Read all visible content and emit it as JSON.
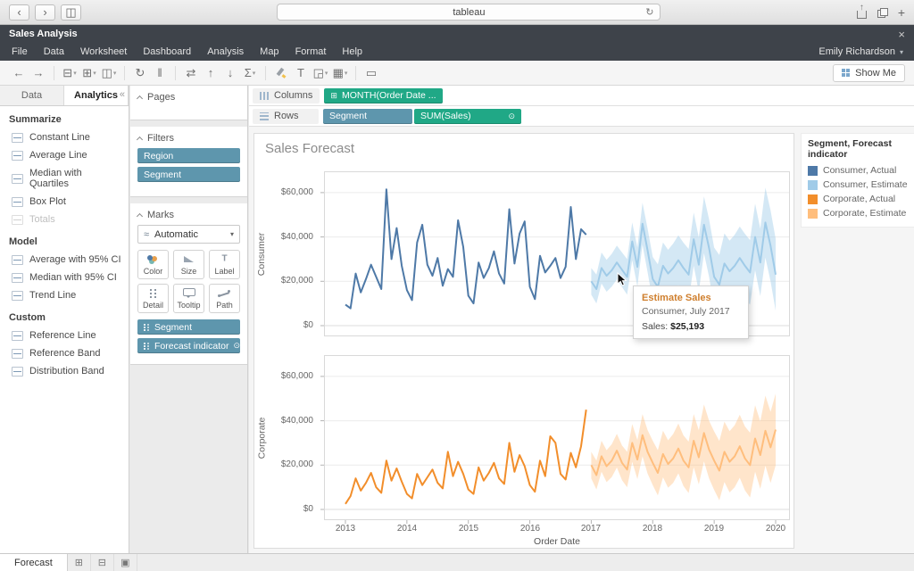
{
  "browser": {
    "title": "tableau"
  },
  "app": {
    "window_title": "Sales Analysis",
    "menus": [
      "File",
      "Data",
      "Worksheet",
      "Dashboard",
      "Analysis",
      "Map",
      "Format",
      "Help"
    ],
    "user": "Emily Richardson"
  },
  "icons": {
    "back": "‹",
    "forward": "›",
    "sidebar": "◫",
    "reload": "↻",
    "plus": "+",
    "close": "×",
    "caret": "▾",
    "collapse": "«",
    "wave": "≈",
    "calendar": "⊞",
    "forecast": "⊙"
  },
  "toolbar": {
    "show_me": "Show Me",
    "icons": [
      {
        "name": "undo-icon",
        "glyph": "←"
      },
      {
        "name": "redo-icon",
        "glyph": "→"
      },
      {
        "name": "separator"
      },
      {
        "name": "new-datasource-icon",
        "glyph": "⊟",
        "caret": true
      },
      {
        "name": "new-worksheet-icon",
        "glyph": "⊞",
        "caret": true
      },
      {
        "name": "duplicate-icon",
        "glyph": "◫",
        "caret": true
      },
      {
        "name": "separator"
      },
      {
        "name": "refresh-icon",
        "glyph": "↻"
      },
      {
        "name": "pause-icon",
        "glyph": "‖"
      },
      {
        "name": "separator"
      },
      {
        "name": "swap-icon",
        "glyph": "⇄"
      },
      {
        "name": "sort-ascending-icon",
        "glyph": "↑"
      },
      {
        "name": "sort-descending-icon",
        "glyph": "↓"
      },
      {
        "name": "totals-icon",
        "glyph": "Σ",
        "caret": true
      },
      {
        "name": "separator"
      },
      {
        "name": "highlight-pen-icon",
        "glyph": "pen"
      },
      {
        "name": "text-label-icon",
        "glyph": "T"
      },
      {
        "name": "fit-icon",
        "glyph": "◲",
        "caret": true
      },
      {
        "name": "cell-size-icon",
        "glyph": "▦",
        "caret": true
      },
      {
        "name": "separator"
      },
      {
        "name": "presentation-icon",
        "glyph": "▭"
      }
    ]
  },
  "sidebar": {
    "tabs": [
      "Data",
      "Analytics"
    ],
    "active_tab": "Analytics",
    "sections": [
      {
        "title": "Summarize",
        "items": [
          {
            "label": "Constant Line",
            "icon": "constant-line-icon"
          },
          {
            "label": "Average Line",
            "icon": "average-line-icon"
          },
          {
            "label": "Median with Quartiles",
            "icon": "median-quartiles-icon"
          },
          {
            "label": "Box Plot",
            "icon": "box-plot-icon"
          },
          {
            "label": "Totals",
            "icon": "totals-icon",
            "disabled": true
          }
        ]
      },
      {
        "title": "Model",
        "items": [
          {
            "label": "Average with 95% CI",
            "icon": "average-ci-icon"
          },
          {
            "label": "Median with 95% CI",
            "icon": "median-ci-icon"
          },
          {
            "label": "Trend Line",
            "icon": "trend-line-icon"
          }
        ]
      },
      {
        "title": "Custom",
        "items": [
          {
            "label": "Reference Line",
            "icon": "reference-line-icon"
          },
          {
            "label": "Reference Band",
            "icon": "reference-band-icon"
          },
          {
            "label": "Distribution Band",
            "icon": "distribution-band-icon"
          }
        ]
      }
    ]
  },
  "cards": {
    "pages": {
      "title": "Pages"
    },
    "filters": {
      "title": "Filters",
      "pills": [
        "Region",
        "Segment"
      ]
    },
    "marks": {
      "title": "Marks",
      "mark_type": "Automatic",
      "buttons": [
        {
          "label": "Color",
          "icon": "color-icon"
        },
        {
          "label": "Size",
          "icon": "size-icon"
        },
        {
          "label": "Label",
          "icon": "label-icon"
        },
        {
          "label": "Detail",
          "icon": "detail-icon"
        },
        {
          "label": "Tooltip",
          "icon": "tooltip-icon"
        },
        {
          "label": "Path",
          "icon": "path-icon"
        }
      ],
      "pills": [
        {
          "label": "Segment"
        },
        {
          "label": "Forecast indicator",
          "trailing_icon": "forecast-indicator-icon"
        }
      ]
    }
  },
  "shelves": {
    "columns": {
      "label": "Columns",
      "pills": [
        {
          "label": "MONTH(Order Date ...",
          "color": "green",
          "leading_icon": "calendar-plus-icon"
        }
      ]
    },
    "rows": {
      "label": "Rows",
      "pills": [
        {
          "label": "Segment",
          "color": "blue"
        },
        {
          "label": "SUM(Sales)",
          "color": "green",
          "trailing_icon": "forecast-indicator-icon"
        }
      ]
    }
  },
  "sheet": {
    "title": "Sales Forecast",
    "legend": {
      "title": "Segment, Forecast indicator",
      "items": [
        {
          "label": "Consumer, Actual",
          "color": "#4e79a7"
        },
        {
          "label": "Consumer, Estimate",
          "color": "#a0cbe8"
        },
        {
          "label": "Corporate, Actual",
          "color": "#f28e2b"
        },
        {
          "label": "Corporate, Estimate",
          "color": "#ffbe7d"
        }
      ]
    },
    "tooltip": {
      "title": "Estimate Sales",
      "subtitle": "Consumer, July 2017",
      "value_label": "Sales: ",
      "value": "$25,193"
    }
  },
  "statusbar": {
    "active_sheet": "Forecast",
    "icons": [
      {
        "name": "new-worksheet-tab-icon",
        "glyph": "⊞"
      },
      {
        "name": "new-dashboard-tab-icon",
        "glyph": "⊟"
      },
      {
        "name": "new-story-tab-icon",
        "glyph": "▣"
      }
    ]
  },
  "chart_data": {
    "type": "line",
    "title": "Sales Forecast",
    "x_label": "Order Date",
    "x_ticks": [
      "2013",
      "2014",
      "2015",
      "2016",
      "2017",
      "2018",
      "2019",
      "2020"
    ],
    "y_ticks": [
      0,
      20000,
      40000,
      60000
    ],
    "y_tick_labels": [
      "$0",
      "$20,000",
      "$40,000",
      "$60,000"
    ],
    "y_max": 68000,
    "forecast_start_month": 48,
    "legend_position": "top-right",
    "grid": true,
    "panels": [
      {
        "name": "Consumer",
        "actual_color": "#4e79a7",
        "estimate_color": "#a0cbe8",
        "band_color": "rgba(160,203,232,0.45)",
        "actual": [
          9500,
          7800,
          23500,
          15000,
          21000,
          27500,
          22000,
          16500,
          61500,
          30000,
          44000,
          27000,
          16000,
          11500,
          37500,
          45500,
          27500,
          22500,
          30500,
          18000,
          25500,
          22000,
          47500,
          35500,
          13500,
          10000,
          28500,
          21500,
          26000,
          33500,
          23500,
          19000,
          52500,
          28000,
          41500,
          47000,
          17500,
          12000,
          31500,
          24000,
          27000,
          30500,
          21500,
          26500,
          53500,
          30000,
          43500,
          41000
        ],
        "estimate": [
          20000,
          16500,
          26000,
          22500,
          25000,
          28500,
          25193,
          22000,
          38000,
          26500,
          46000,
          34000,
          21000,
          17500,
          27000,
          23500,
          26000,
          29500,
          26000,
          23000,
          39000,
          27500,
          45500,
          35000,
          22000,
          18500,
          28000,
          24500,
          27000,
          30500,
          27000,
          24000,
          40000,
          28500,
          46500,
          36000,
          23000
        ],
        "band": [
          6000,
          6500,
          7000,
          7200,
          7400,
          7600,
          7800,
          8000,
          8500,
          8800,
          9500,
          9800,
          10000,
          10200,
          10500,
          10700,
          11000,
          11200,
          11400,
          11600,
          12000,
          12200,
          12800,
          13000,
          13200,
          13400,
          13600,
          13800,
          14000,
          14200,
          14400,
          14600,
          15000,
          15200,
          15800,
          16000,
          16200
        ]
      },
      {
        "name": "Corporate",
        "actual_color": "#f28e2b",
        "estimate_color": "#ffbe7d",
        "band_color": "rgba(255,190,125,0.4)",
        "actual": [
          2500,
          6000,
          14000,
          8500,
          12000,
          16500,
          10000,
          7500,
          22000,
          13000,
          18500,
          12500,
          7000,
          5000,
          16000,
          11000,
          14500,
          18000,
          12000,
          9500,
          26000,
          15000,
          21500,
          16000,
          9000,
          7000,
          19000,
          13000,
          16500,
          21000,
          14000,
          11500,
          30000,
          17000,
          24500,
          19500,
          11000,
          8000,
          22000,
          15000,
          33000,
          30000,
          16000,
          13500,
          25500,
          19000,
          28500,
          45000
        ],
        "estimate": [
          20000,
          15500,
          24000,
          19500,
          22000,
          26500,
          21000,
          18000,
          30000,
          22500,
          33500,
          26000,
          21000,
          16500,
          25000,
          20500,
          23000,
          27500,
          22000,
          19000,
          31000,
          23500,
          34500,
          27000,
          22000,
          17500,
          26000,
          21500,
          24000,
          28500,
          23000,
          20000,
          32000,
          24500,
          35500,
          28000,
          36000
        ],
        "band": [
          6000,
          6500,
          7000,
          7200,
          7400,
          7600,
          7800,
          8000,
          8500,
          8800,
          9500,
          9800,
          10000,
          10200,
          10500,
          10700,
          11000,
          11200,
          11400,
          11600,
          12000,
          12200,
          12800,
          13000,
          13200,
          13400,
          13600,
          13800,
          14000,
          14200,
          14400,
          14600,
          15000,
          15200,
          15800,
          16000,
          16200
        ]
      }
    ]
  }
}
